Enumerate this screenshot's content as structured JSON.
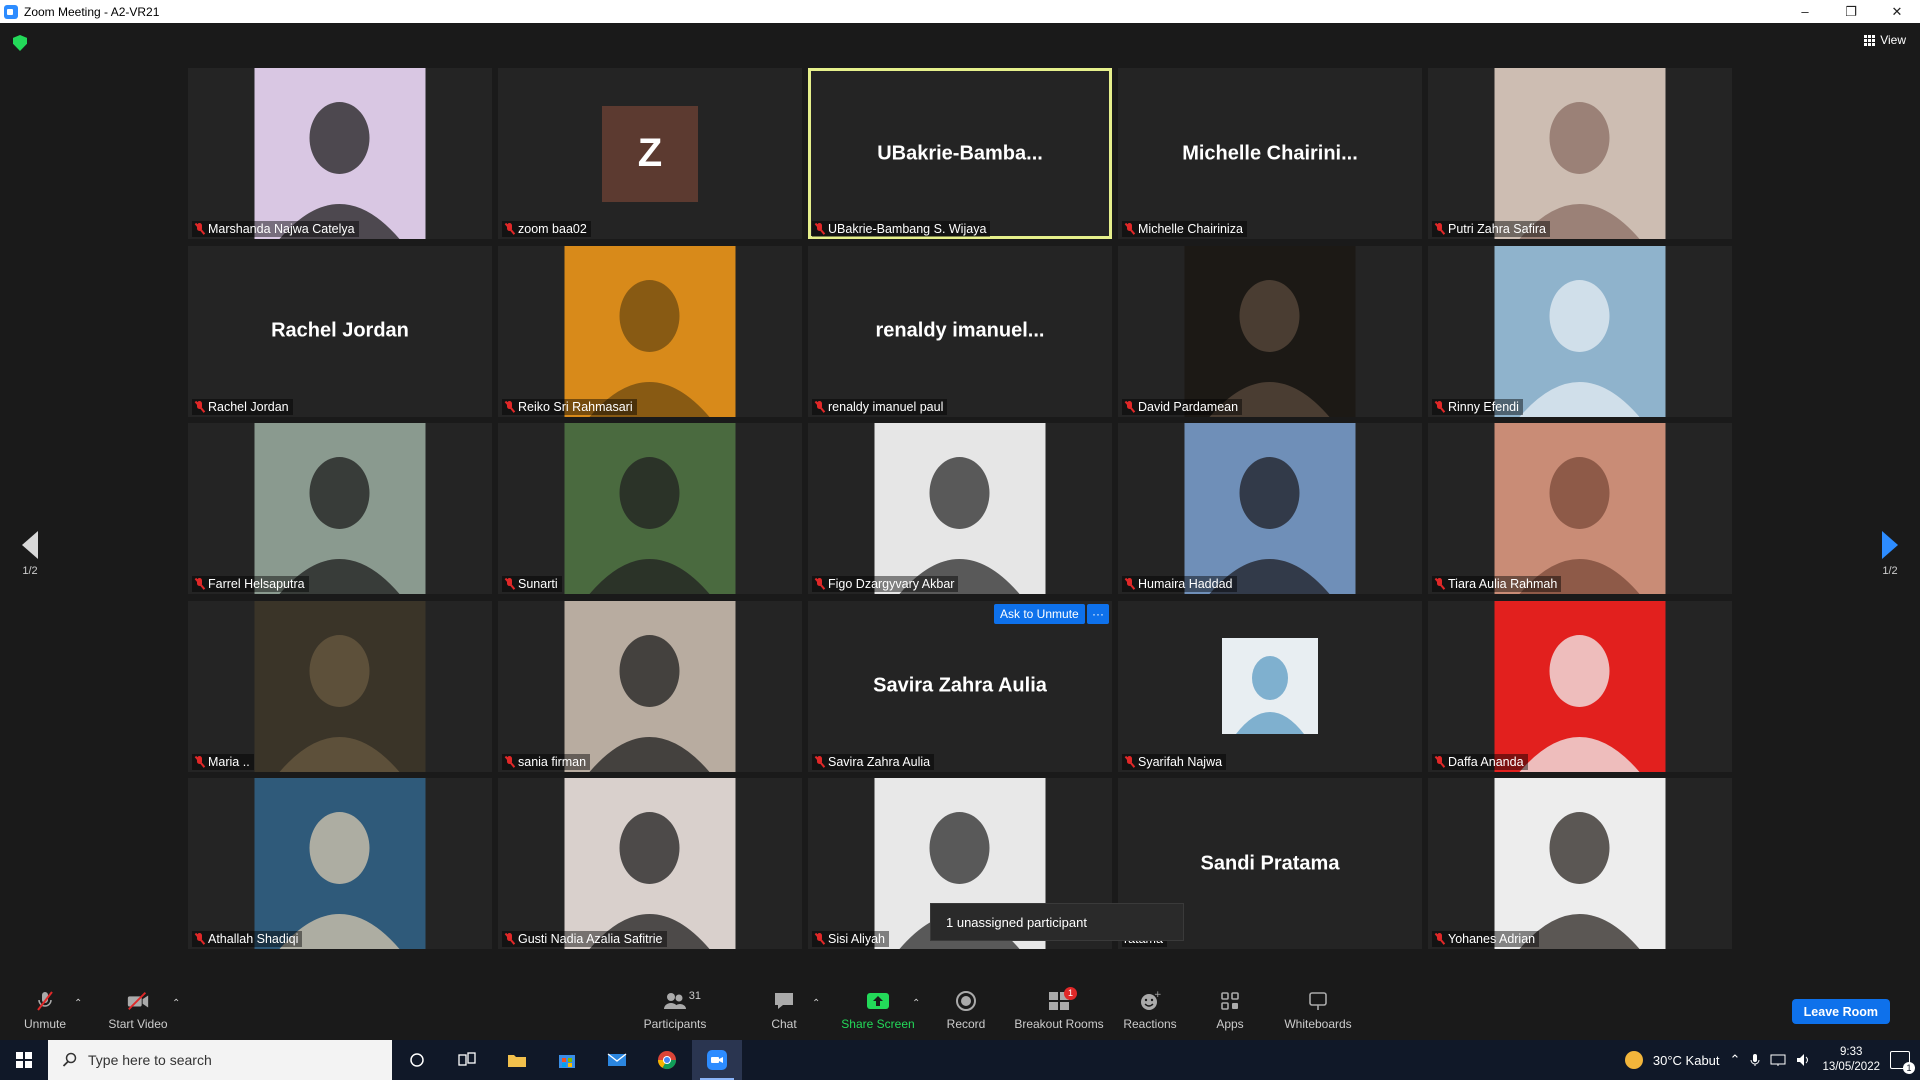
{
  "window": {
    "title": "Zoom Meeting - A2-VR21"
  },
  "header": {
    "view_label": "View"
  },
  "tiles": [
    {
      "name": "Marshanda Najwa Catelya",
      "kind": "photo",
      "bg": "#d9c7e3",
      "fg": "#1d1d1d"
    },
    {
      "name": "zoom baa02",
      "kind": "initial",
      "initial": "Z"
    },
    {
      "name": "UBakrie-Bambang S. Wijaya",
      "kind": "text",
      "display": "UBakrie-Bamba..."
    },
    {
      "name": "Michelle Chairiniza",
      "kind": "text",
      "display": "Michelle  Chairini..."
    },
    {
      "name": "Putri Zahra Safira",
      "kind": "photo",
      "bg": "#cdbdb2",
      "fg": "#8a6e63"
    },
    {
      "name": "Rachel Jordan",
      "kind": "text",
      "display": "Rachel Jordan"
    },
    {
      "name": "Reiko Sri Rahmasari",
      "kind": "photo",
      "bg": "#d88a1a",
      "fg": "#6e4a12"
    },
    {
      "name": "renaldy imanuel paul",
      "kind": "text",
      "display": "renaldy  imanuel..."
    },
    {
      "name": "David Pardamean",
      "kind": "photo",
      "bg": "#1c1915",
      "fg": "#5a4a3c"
    },
    {
      "name": "Rinny Efendi",
      "kind": "photo",
      "bg": "#8fb3cc",
      "fg": "#e6eef4"
    },
    {
      "name": "Farrel Helsaputra",
      "kind": "photo",
      "bg": "#8a9a8f",
      "fg": "#1c1c1c"
    },
    {
      "name": "Sunarti",
      "kind": "photo",
      "bg": "#4a6a3f",
      "fg": "#222"
    },
    {
      "name": "Figo Dzargyvary Akbar",
      "kind": "photo",
      "bg": "#e6e6e6",
      "fg": "#2a2a2a"
    },
    {
      "name": "Humaira Haddad",
      "kind": "photo",
      "bg": "#6f8fb8",
      "fg": "#1e1e24"
    },
    {
      "name": "Tiara Aulia Rahmah",
      "kind": "photo",
      "bg": "#c98c76",
      "fg": "#7a4a3a"
    },
    {
      "name": "Maria ..",
      "kind": "photo",
      "bg": "#3a3428",
      "fg": "#6a5a40"
    },
    {
      "name": "sania firman",
      "kind": "photo",
      "bg": "#b8aca0",
      "fg": "#1e1e1e"
    },
    {
      "name": "Savira Zahra Aulia",
      "kind": "text",
      "display": "Savira Zahra Aulia"
    },
    {
      "name": "Syarifah Najwa",
      "kind": "smallphoto",
      "bg": "#e8eef2",
      "fg": "#7fb0cf"
    },
    {
      "name": "Daffa Ananda",
      "kind": "photo",
      "bg": "#e2201e",
      "fg": "#f2f2f2"
    },
    {
      "name": "Athallah Shadiqi",
      "kind": "photo",
      "bg": "#2f5a7a",
      "fg": "#d8c9b0"
    },
    {
      "name": "Gusti Nadia Azalia Safitrie",
      "kind": "photo",
      "bg": "#d9d0cc",
      "fg": "#1e1e1e"
    },
    {
      "name": "Sisi Aliyah",
      "kind": "photo",
      "bg": "#e8e8e8",
      "fg": "#2a2a2a"
    },
    {
      "name": "Sandi Pratama",
      "kind": "text",
      "display": "Sandi Pratama",
      "nameplate_override": "ratama"
    },
    {
      "name": "Yohanes Adrian",
      "kind": "photo",
      "bg": "#ededed",
      "fg": "#2a2420"
    }
  ],
  "ask_unmute": {
    "label": "Ask to Unmute",
    "more": "···"
  },
  "tooltip": {
    "text": "1 unassigned participant"
  },
  "pagination": {
    "left": "1/2",
    "right": "1/2"
  },
  "toolbar": {
    "unmute": "Unmute",
    "start_video": "Start Video",
    "participants": "Participants",
    "participants_count": "31",
    "chat": "Chat",
    "share_screen": "Share Screen",
    "record": "Record",
    "breakout_rooms": "Breakout Rooms",
    "breakout_badge": "1",
    "reactions": "Reactions",
    "apps": "Apps",
    "whiteboards": "Whiteboards",
    "leave": "Leave Room"
  },
  "taskbar": {
    "search_placeholder": "Type here to search",
    "weather": "30°C  Kabut",
    "time": "9:33",
    "date": "13/05/2022",
    "notifications": "1"
  },
  "colors": {
    "zoom_blue": "#0e71eb",
    "active_speaker": "#e6f08c",
    "share_green": "#23d959",
    "muted_red": "#e02828"
  }
}
